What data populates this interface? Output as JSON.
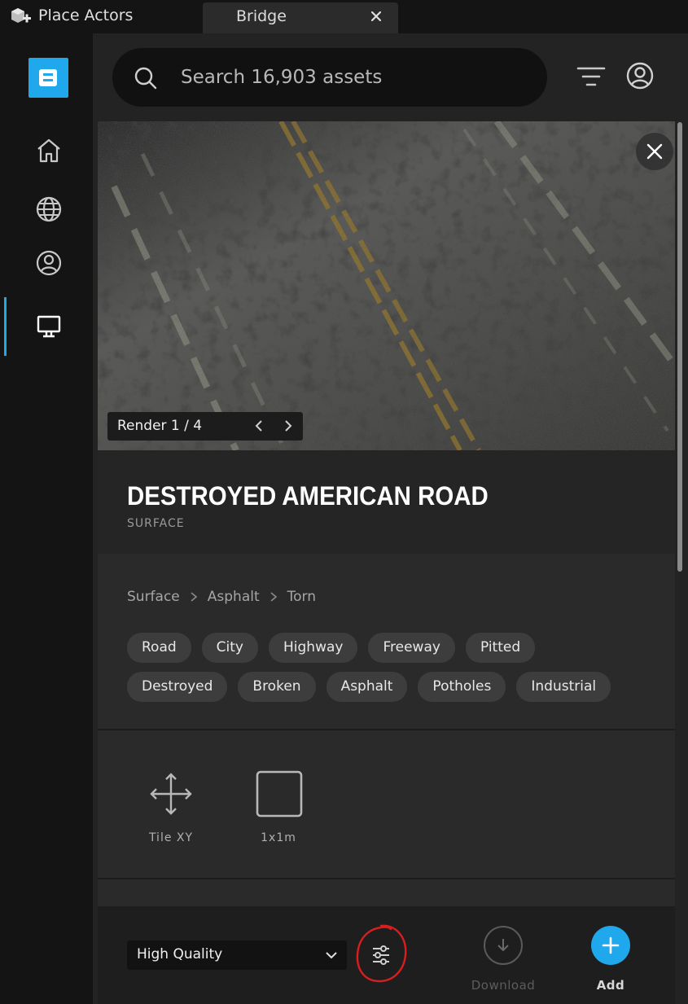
{
  "window": {
    "app_title": "Place Actors",
    "tab_label": "Bridge"
  },
  "sidebar": {
    "logo_letter": "B",
    "items": [
      {
        "name": "home-icon"
      },
      {
        "name": "globe-icon"
      },
      {
        "name": "user-circle-icon"
      },
      {
        "name": "monitor-icon",
        "active": true
      }
    ]
  },
  "search": {
    "placeholder": "Search 16,903 assets"
  },
  "viewer": {
    "render_label": "Render 1 / 4"
  },
  "asset": {
    "title": "DESTROYED AMERICAN ROAD",
    "type": "SURFACE",
    "breadcrumb": [
      "Surface",
      "Asphalt",
      "Torn"
    ],
    "tags_row1": [
      "Road",
      "City",
      "Highway",
      "Freeway",
      "Pitted"
    ],
    "tags_row2": [
      "Destroyed",
      "Broken",
      "Asphalt",
      "Potholes",
      "Industrial"
    ],
    "properties": [
      {
        "icon": "move-arrows-icon",
        "label": "Tile XY"
      },
      {
        "icon": "square-icon",
        "label": "1x1m"
      }
    ]
  },
  "footer": {
    "quality_selected": "High Quality",
    "download_label": "Download",
    "add_label": "Add"
  },
  "colors": {
    "accent": "#1fa8ec",
    "annotation_red": "#d81e1e"
  }
}
